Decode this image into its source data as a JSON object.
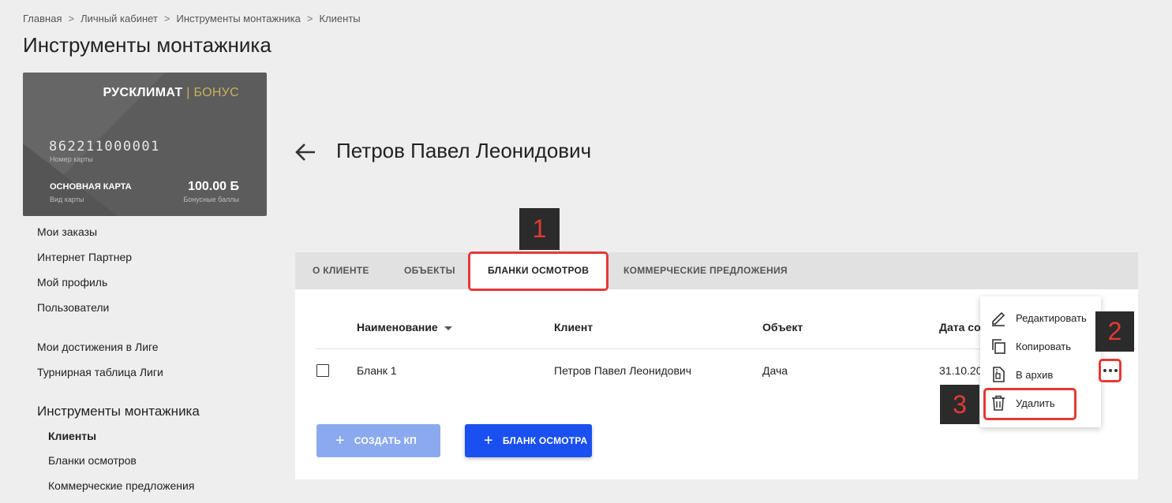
{
  "breadcrumb": [
    "Главная",
    "Личный кабинет",
    "Инструменты монтажника",
    "Клиенты"
  ],
  "breadcrumb_separator": ">",
  "page_title": "Инструменты монтажника",
  "card": {
    "brand": "РУСКЛИМАТ",
    "brand_divider": "|",
    "brand_bonus": "БОНУС",
    "number": "862211000001",
    "number_label": "Номер карты",
    "type": "ОСНОВНАЯ КАРТА",
    "type_label": "Вид карты",
    "points": "100.00 Б",
    "points_label": "Бонусные баллы",
    "accent_color": "#c9b25a"
  },
  "sidenav": {
    "items_top": [
      "Мои заказы",
      "Интернет Партнер",
      "Мой профиль",
      "Пользователи"
    ],
    "items_league": [
      "Мои достижения в Лиге",
      "Турнирная таблица Лиги"
    ],
    "section": "Инструменты монтажника",
    "sub_items": [
      "Клиенты",
      "Бланки осмотров",
      "Коммерческие предложения"
    ],
    "active_sub": "Клиенты"
  },
  "client_name": "Петров Павел Леонидович",
  "tabs": [
    "О КЛИЕНТЕ",
    "ОБЪЕКТЫ",
    "БЛАНКИ ОСМОТРОВ",
    "КОММЕРЧЕСКИЕ ПРЕДЛОЖЕНИЯ"
  ],
  "active_tab": "БЛАНКИ ОСМОТРОВ",
  "table": {
    "columns": [
      "Наименование",
      "Клиент",
      "Объект",
      "Дата со"
    ],
    "rows": [
      {
        "name": "Бланк 1",
        "client": "Петров Павел Леонидович",
        "object": "Дача",
        "date": "31.10.20"
      }
    ]
  },
  "buttons": {
    "create_kp": "СОЗДАТЬ КП",
    "inspection_form": "БЛАНК ОСМОТРА",
    "primary_color": "#1a50f0",
    "disabled_color": "#8aa9ef"
  },
  "context_menu": {
    "items": [
      {
        "label": "Редактировать",
        "icon": "pencil-icon"
      },
      {
        "label": "Копировать",
        "icon": "copy-icon"
      },
      {
        "label": "В архив",
        "icon": "archive-file-icon"
      },
      {
        "label": "Удалить",
        "icon": "trash-icon"
      }
    ]
  },
  "callouts": [
    "1",
    "2",
    "3"
  ],
  "highlight_color": "#e53935"
}
